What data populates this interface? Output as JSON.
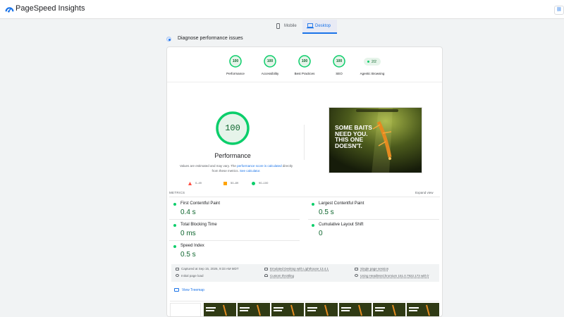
{
  "app": {
    "title": "PageSpeed Insights",
    "share_label": "⛓",
    "icon": "pagespeed-logo"
  },
  "device_tabs": [
    {
      "label": "Mobile",
      "icon": "phone-icon",
      "selected": false
    },
    {
      "label": "Desktop",
      "icon": "laptop-icon",
      "selected": true
    }
  ],
  "diagnose": {
    "title": "Diagnose performance issues"
  },
  "categories": [
    {
      "score": "100",
      "label": "Performance"
    },
    {
      "score": "100",
      "label": "Accessibility"
    },
    {
      "score": "100",
      "label": "Best Practices"
    },
    {
      "score": "100",
      "label": "SEO"
    }
  ],
  "agentic": {
    "value": "2/2",
    "label": "Agentic Browsing"
  },
  "performance": {
    "score": "100",
    "title": "Performance",
    "desc_1": "Values are estimated and may vary. The ",
    "desc_link_1": "performance score is calculated",
    "desc_2": " directly from these metrics. ",
    "desc_link_2": "See calculator."
  },
  "legend": [
    {
      "label": "0–49",
      "color": "#ff4e42"
    },
    {
      "label": "50–89",
      "color": "#ffa400"
    },
    {
      "label": "90–100",
      "color": "#0cce6b"
    }
  ],
  "screenshot": {
    "headline": [
      "SOME BAITS",
      "NEED YOU.",
      "THIS ONE",
      "DOESN'T."
    ]
  },
  "metrics_section": {
    "label": "METRICS",
    "expand_label": "Expand view"
  },
  "metrics": [
    {
      "title": "First Contentful Paint",
      "value": "0.4 s"
    },
    {
      "title": "Largest Contentful Paint",
      "value": "0.5 s"
    },
    {
      "title": "Total Blocking Time",
      "value": "0 ms"
    },
    {
      "title": "Cumulative Layout Shift",
      "value": "0"
    },
    {
      "title": "Speed Index",
      "value": "0.5 s"
    }
  ],
  "info": {
    "captured": "Captured at Sep 15, 2026, 9:33 AM MDT",
    "initial_load": "Initial page load",
    "emulated": "Emulated Desktop with Lighthouse 13.4.1",
    "throttling": "Custom throttling",
    "session": "Single page session",
    "browser": "Using HeadlessChromium 151.0.7922.173 with lr"
  },
  "treemap": {
    "label": "View Treemap"
  },
  "colors": {
    "good": "#0cce6b",
    "good_text": "#0d652d",
    "accent": "#1a73e8"
  }
}
